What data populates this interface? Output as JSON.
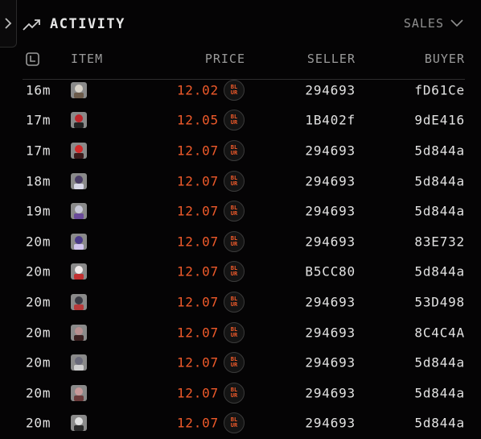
{
  "header": {
    "title": "ACTIVITY",
    "filter_label": "SALES"
  },
  "columns": {
    "item": "ITEM",
    "price": "PRICE",
    "seller": "SELLER",
    "buyer": "BUYER"
  },
  "currency_badge": "BL UR",
  "colors": {
    "price": "#ef5a2a",
    "background": "#050405"
  },
  "rows": [
    {
      "time": "16m",
      "price": "12.02",
      "seller": "294693",
      "buyer": "fD61Ce",
      "thumb": [
        "#d8d2c8",
        "#6b5a4a"
      ]
    },
    {
      "time": "17m",
      "price": "12.05",
      "seller": "1B402f",
      "buyer": "9dE416",
      "thumb": [
        "#c0262b",
        "#222222"
      ]
    },
    {
      "time": "17m",
      "price": "12.07",
      "seller": "294693",
      "buyer": "5d844a",
      "thumb": [
        "#d42a2a",
        "#3a1a1a"
      ]
    },
    {
      "time": "18m",
      "price": "12.07",
      "seller": "294693",
      "buyer": "5d844a",
      "thumb": [
        "#4a3d66",
        "#d8d8e8"
      ]
    },
    {
      "time": "19m",
      "price": "12.07",
      "seller": "294693",
      "buyer": "5d844a",
      "thumb": [
        "#c8c8d8",
        "#6a4a9a"
      ]
    },
    {
      "time": "20m",
      "price": "12.07",
      "seller": "294693",
      "buyer": "83E732",
      "thumb": [
        "#4b3a8a",
        "#d0c4ee"
      ]
    },
    {
      "time": "20m",
      "price": "12.07",
      "seller": "B5CC80",
      "buyer": "5d844a",
      "thumb": [
        "#f0eaea",
        "#c23030"
      ]
    },
    {
      "time": "20m",
      "price": "12.07",
      "seller": "294693",
      "buyer": "53D498",
      "thumb": [
        "#3a3a44",
        "#b83a3a"
      ]
    },
    {
      "time": "20m",
      "price": "12.07",
      "seller": "294693",
      "buyer": "8C4C4A",
      "thumb": [
        "#b89090",
        "#3a2020"
      ]
    },
    {
      "time": "20m",
      "price": "12.07",
      "seller": "294693",
      "buyer": "5d844a",
      "thumb": [
        "#6a6a7a",
        "#d0d0d0"
      ]
    },
    {
      "time": "20m",
      "price": "12.07",
      "seller": "294693",
      "buyer": "5d844a",
      "thumb": [
        "#c89a9a",
        "#6a3a3a"
      ]
    },
    {
      "time": "20m",
      "price": "12.07",
      "seller": "294693",
      "buyer": "5d844a",
      "thumb": [
        "#e0e0e0",
        "#2a2a2a"
      ]
    }
  ]
}
